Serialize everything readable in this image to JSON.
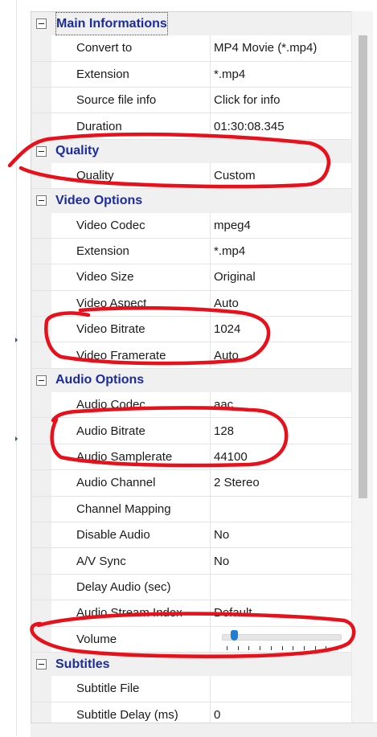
{
  "grid": {
    "categories": [
      {
        "title": "Main Informations",
        "focused": true,
        "rows": [
          {
            "name": "Convert to",
            "value": "MP4 Movie (*.mp4)"
          },
          {
            "name": "Extension",
            "value": "*.mp4"
          },
          {
            "name": "Source file info",
            "value": "Click for info"
          },
          {
            "name": "Duration",
            "value": "01:30:08.345"
          }
        ]
      },
      {
        "title": "Quality",
        "rows": [
          {
            "name": "Quality",
            "value": "Custom"
          }
        ]
      },
      {
        "title": "Video Options",
        "rows": [
          {
            "name": "Video Codec",
            "value": "mpeg4"
          },
          {
            "name": "Extension",
            "value": "*.mp4"
          },
          {
            "name": "Video Size",
            "value": "Original"
          },
          {
            "name": "Video Aspect",
            "value": "Auto"
          },
          {
            "name": "Video Bitrate",
            "value": "1024"
          },
          {
            "name": "Video Framerate",
            "value": "Auto"
          }
        ]
      },
      {
        "title": "Audio Options",
        "rows": [
          {
            "name": "Audio Codec",
            "value": "aac"
          },
          {
            "name": "Audio Bitrate",
            "value": "128"
          },
          {
            "name": "Audio Samplerate",
            "value": "44100"
          },
          {
            "name": "Audio Channel",
            "value": "2 Stereo"
          },
          {
            "name": "Channel Mapping",
            "value": ""
          },
          {
            "name": "Disable Audio",
            "value": "No"
          },
          {
            "name": "A/V Sync",
            "value": "No"
          },
          {
            "name": "Delay Audio (sec)",
            "value": ""
          },
          {
            "name": "Audio Stream Index",
            "value": "Default"
          },
          {
            "name": "Volume",
            "value": "",
            "slider": {
              "level": 0.1,
              "ticks": 11
            }
          }
        ]
      },
      {
        "title": "Subtitles",
        "rows": [
          {
            "name": "Subtitle File",
            "value": ""
          },
          {
            "name": "Subtitle Delay (ms)",
            "value": "0"
          }
        ]
      }
    ]
  },
  "colors": {
    "category_text": "#1c2c9c",
    "annotation_red": "#e8101a",
    "slider_thumb": "#1e7fd6"
  },
  "icons": {
    "expander": "collapse-minus-icon",
    "splitter": "arrow-right-icon"
  }
}
